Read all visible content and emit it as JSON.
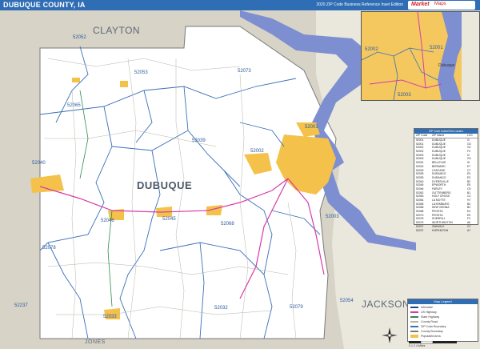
{
  "header": {
    "title": "DUBUQUE COUNTY, IA",
    "edition": "2020 ZIP Code Business Reference Inset Edition"
  },
  "logo": {
    "brand": "Market",
    "brand2": "Maps"
  },
  "counties": {
    "main": "DUBUQUE",
    "clayton": "CLAYTON",
    "jackson": "JACKSON",
    "jones": "JONES"
  },
  "zip_labels": {
    "z52052": "52052",
    "z52053": "52053",
    "z52073": "52073",
    "z52065": "52065",
    "z52039": "52039",
    "z52001": "52001",
    "z52002": "52002",
    "z52040": "52040",
    "z52045": "52045",
    "z52068": "52068",
    "z52003": "52003",
    "z52046": "52046",
    "z52078": "52078",
    "z52237": "52237",
    "z52032": "52032",
    "z52079": "52079",
    "z52054": "52054",
    "z52033": "52033"
  },
  "inset": {
    "z52002": "52002",
    "z52001": "52001",
    "z52003": "52003",
    "city": "Dubuque"
  },
  "zip_table": {
    "title": "ZIP Code Index/Grid Locator",
    "headers": [
      "ZIP Code",
      "ZIP Name",
      "LOC"
    ],
    "rows": [
      [
        "52001",
        "DUBUQUE",
        "I1"
      ],
      [
        "52001",
        "DUBUQUE",
        "G3"
      ],
      [
        "52002",
        "DUBUQUE",
        "G2"
      ],
      [
        "52002",
        "DUBUQUE",
        "F3"
      ],
      [
        "52003",
        "DUBUQUE",
        "I2"
      ],
      [
        "52003",
        "DUBUQUE",
        "G3"
      ],
      [
        "52031",
        "BELLEVUE",
        "I6"
      ],
      [
        "52032",
        "BERNARD",
        "E7"
      ],
      [
        "52033",
        "CASCADE",
        "C7"
      ],
      [
        "52039",
        "DURANGO",
        "E3"
      ],
      [
        "52039",
        "DURANGO",
        "E3"
      ],
      [
        "52040",
        "DYERSVILLE",
        "B2"
      ],
      [
        "52045",
        "EPWORTH",
        "E5"
      ],
      [
        "52046",
        "FARLEY",
        "C5"
      ],
      [
        "52052",
        "GUTTENBERG",
        "B1"
      ],
      [
        "52053",
        "HOLY CROSS",
        "C2"
      ],
      [
        "52054",
        "LA MOTTE",
        "H7"
      ],
      [
        "52065",
        "LUXEMBURG",
        "B2"
      ],
      [
        "52068",
        "NEW VIENNA",
        "B2"
      ],
      [
        "52068",
        "PEOSTA",
        "E4"
      ],
      [
        "52073",
        "PEOSTA",
        "E5"
      ],
      [
        "52078",
        "SHERRILL",
        "F2"
      ],
      [
        "52079",
        "WORTHINGTON",
        "A6"
      ],
      [
        "52207",
        "ZWINGLE",
        "G7"
      ],
      [
        "52237",
        "HOPKINTON",
        "A7"
      ]
    ]
  },
  "legend": {
    "title": "Map Legend",
    "items": [
      "Interstate",
      "US Highway",
      "State Highway",
      "County Road",
      "ZIP Code Boundary",
      "County Boundary",
      "Populated Area"
    ]
  },
  "scale": {
    "label": "0 1 2 4 Miles"
  },
  "colors": {
    "header": "#2f6db5",
    "water": "#7d8fd0",
    "urban": "#f4c24a",
    "outside": "#d7d3c6",
    "zip_boundary": "#3a6fb8",
    "highway": "#d63ca8"
  }
}
